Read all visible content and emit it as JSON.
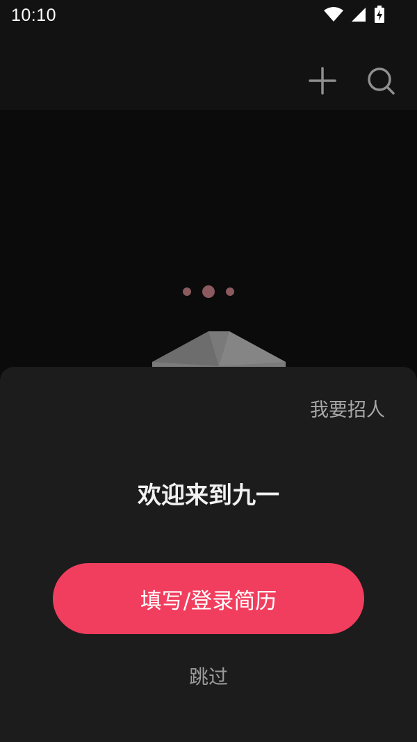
{
  "status_bar": {
    "time": "10:10",
    "icons": [
      "wifi-icon",
      "signal-icon",
      "battery-charging-icon"
    ]
  },
  "top_bar": {
    "icons": [
      "plus-icon",
      "search-icon"
    ]
  },
  "loading": {
    "dot_color": "#8b5a5e"
  },
  "sheet": {
    "recruit_label": "我要招人",
    "welcome_title": "欢迎来到九一",
    "primary_button_label": "填写/登录简历",
    "skip_label": "跳过"
  },
  "colors": {
    "accent": "#f23e5e",
    "background": "#0b0b0b",
    "sheet_background": "#1c1c1c"
  }
}
